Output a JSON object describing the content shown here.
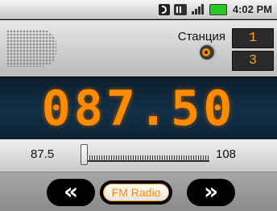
{
  "status_bar": {
    "time": "4:02 PM",
    "icons": [
      "bluetooth-icon",
      "3g-icon",
      "signal-icon",
      "battery-icon"
    ]
  },
  "header": {
    "station_label": "Станция",
    "presets": [
      "1",
      "3"
    ]
  },
  "display": {
    "frequency": "087.50"
  },
  "tuner": {
    "min": "87.5",
    "max": "108",
    "current_value": 87.5
  },
  "controls": {
    "prev_glyph": "«",
    "next_glyph": "»",
    "mode_label": "FM Radio"
  },
  "colors": {
    "accent": "#ff8c00",
    "display_bg": "#123049"
  }
}
